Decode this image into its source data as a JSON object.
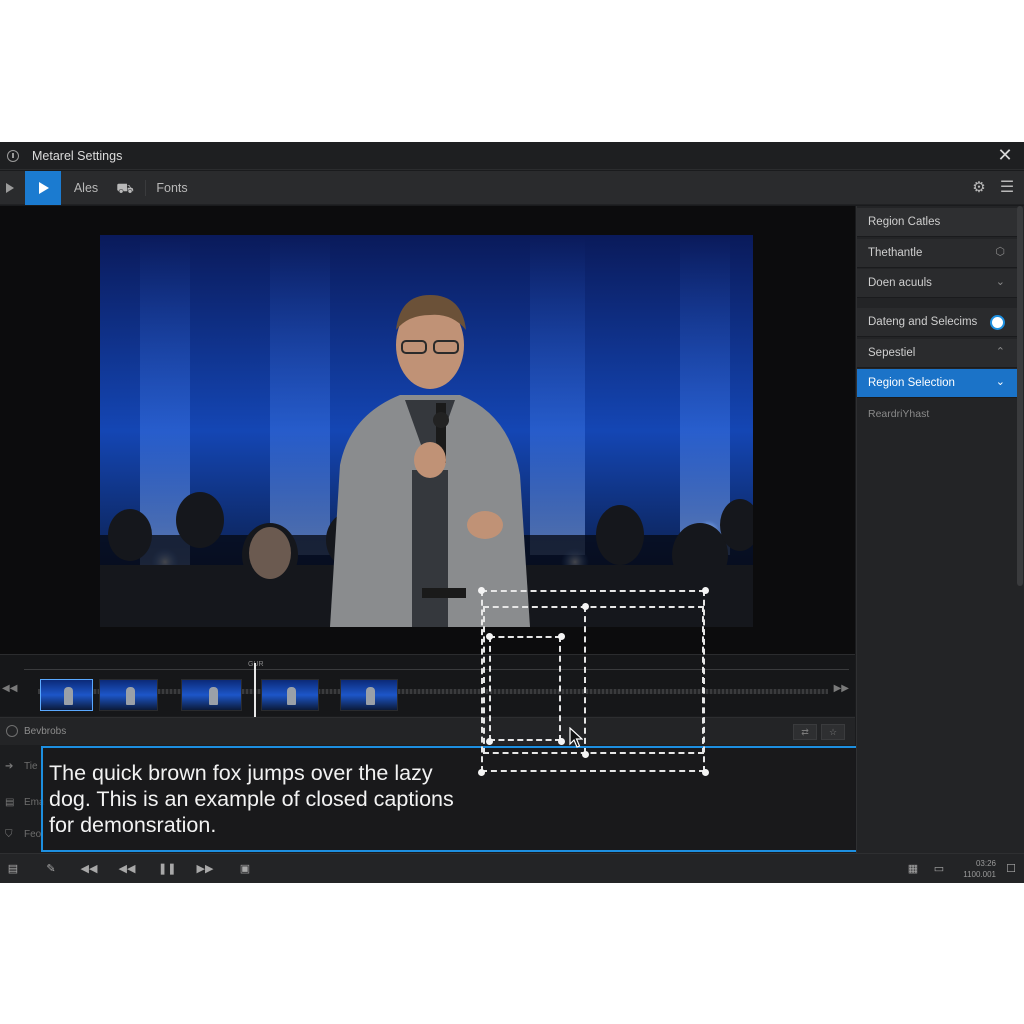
{
  "window": {
    "title": "Metarel Settings"
  },
  "toolbar": {
    "item_ales": "Ales",
    "item_fonts": "Fonts"
  },
  "timeline": {
    "label": "GUR"
  },
  "subpanel": {
    "header_label": "Bevbrobs",
    "rows": [
      "Tie",
      "Ema",
      "Feo"
    ]
  },
  "caption": {
    "text": "The quick brown fox jumps over the lazy dog. This is an example of closed captions for demonsration."
  },
  "bottombar": {
    "time_top": "03:26",
    "time_bottom": "1100.001"
  },
  "right_panel": {
    "items": [
      {
        "label": "Region Catles"
      },
      {
        "label": "Thethantle"
      },
      {
        "label": "Doen acuuls"
      },
      {
        "label": "Dateng and Selecims"
      },
      {
        "label": "Sepestiel"
      },
      {
        "label": "Region Selection"
      }
    ],
    "footer_label": "ReardriYhast"
  },
  "colors": {
    "accent": "#1b7bd0",
    "caption_border": "#1d8fe0",
    "background": "#1a1b1d"
  },
  "icons": [
    "info-icon",
    "close-icon",
    "play-icon",
    "cart-icon",
    "gear-icon",
    "menu-icon",
    "skip-back-icon",
    "skip-forward-icon",
    "pause-icon",
    "fullscreen-icon",
    "captions-icon",
    "chevron-down-icon"
  ]
}
